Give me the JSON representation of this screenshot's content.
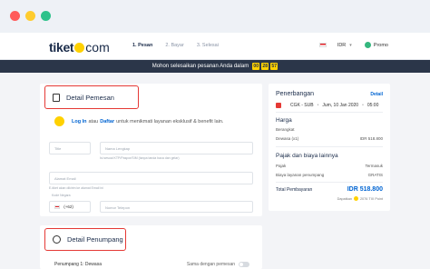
{
  "header": {
    "logo": {
      "brand": "tiket",
      "suffix": "com"
    },
    "steps": [
      "1. Pesan",
      "2. Bayar",
      "3. Selesai"
    ],
    "currency": "IDR",
    "promo": "Promo"
  },
  "banner": {
    "text": "Mohon selesaikan pesanan Anda dalam",
    "timer": [
      "00",
      "28",
      "57"
    ]
  },
  "booking": {
    "title": "Detail Pemesan",
    "login_link": "Log In",
    "or_text": "atau",
    "register_link": "Daftar",
    "login_desc": "untuk menikmati layanan eksklusif & benefit lain.",
    "fields": {
      "title_placeholder": "Title",
      "name_placeholder": "Nama Lengkap",
      "name_hint": "Isi sesuai KTP/Paspor/SIM (tanpa tanda baca dan gelar)",
      "email_placeholder": "Alamat Email",
      "email_hint": "E-tiket akan dikirim ke alamat Email ini",
      "code_label": "Kode Negara",
      "code_value": "(+62)",
      "phone_placeholder": "Nomor Telepon"
    }
  },
  "passenger": {
    "title": "Detail Penumpang",
    "passenger_label": "Penumpang 1: Dewasa",
    "same_as_label": "Sama dengan pemesan"
  },
  "summary": {
    "title": "Penerbangan",
    "detail_link": "Detail",
    "flight_route": "CGK - SUB",
    "flight_date": "Jum, 10 Jan 2020",
    "flight_time": "05:00",
    "price_heading": "Harga",
    "depart_label": "Berangkat",
    "adult_label": "Dewasa (x1)",
    "adult_price": "IDR 518.800",
    "tax_heading": "Pajak dan biaya lainnya",
    "tax_label": "Pajak",
    "tax_value": "Termasuk",
    "service_label": "Biaya layanan penumpang",
    "service_value": "GRATIS",
    "total_label": "Total Pembayaran",
    "total_value": "IDR 518.800",
    "points_prefix": "Dapatkan",
    "points_value": "2076 TIX Point"
  },
  "colors": {
    "accent": "#0064d2",
    "highlight": "#e53935",
    "brand_yellow": "#ffd100",
    "banner_bg": "#2b3649"
  }
}
